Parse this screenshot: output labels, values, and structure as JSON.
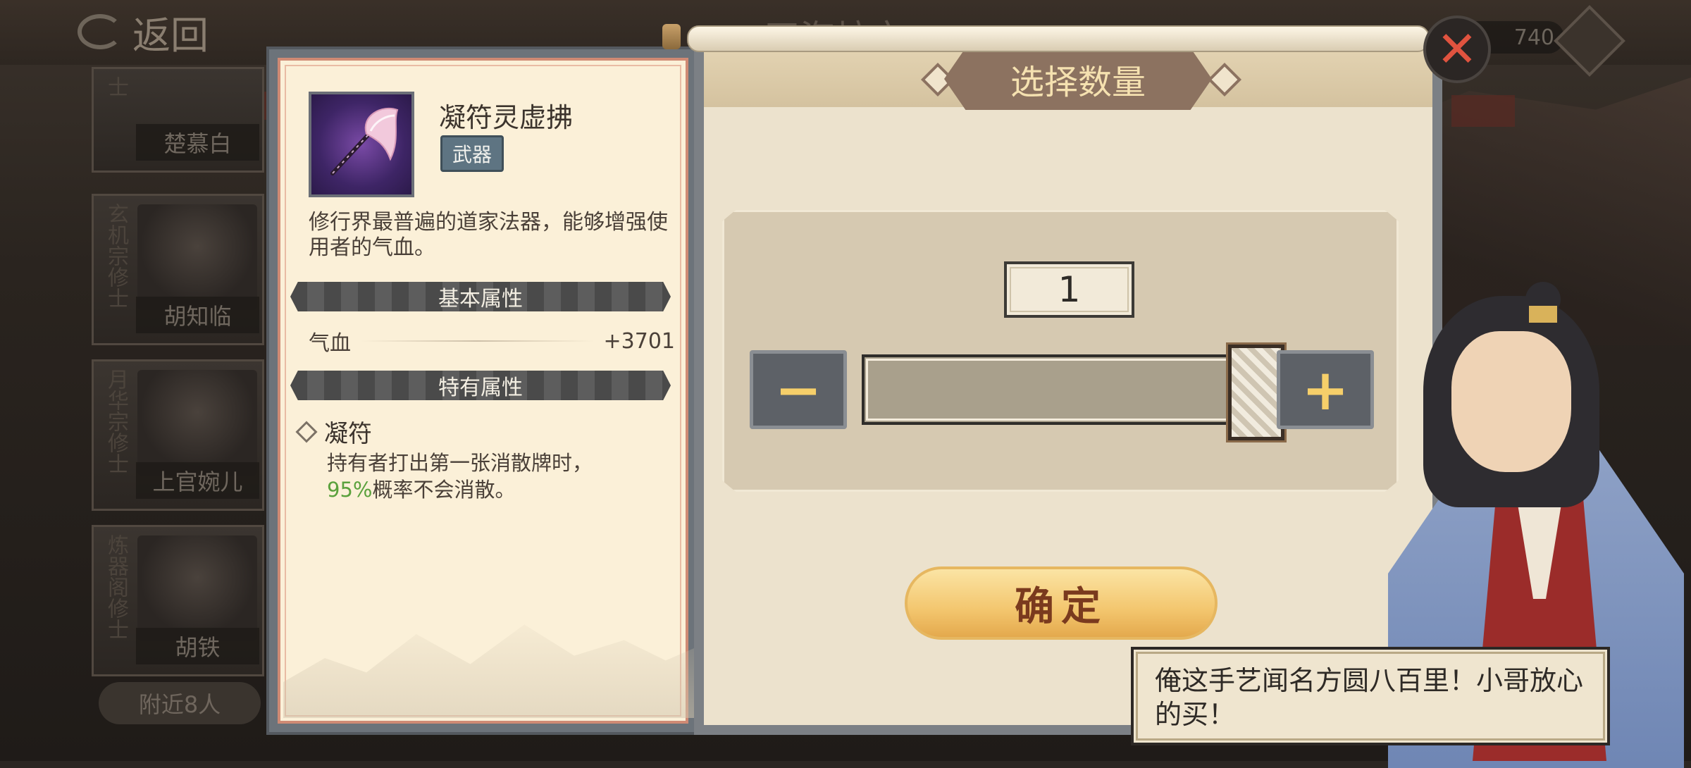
{
  "background": {
    "back_label": "返回",
    "title_partial": "四海坊市",
    "currency_value": "740",
    "side_cards": [
      {
        "sect": "士",
        "name": "楚慕白"
      },
      {
        "sect": "玄机宗修士",
        "name": "胡知临"
      },
      {
        "sect": "月华宗修士",
        "name": "上官婉儿"
      },
      {
        "sect": "炼器阁修士",
        "name": "胡铁"
      }
    ],
    "nearby_label": "附近8人"
  },
  "item": {
    "name": "凝符灵虚拂",
    "tag": "武器",
    "description": "修行界最普遍的道家法器，能够增强使用者的气血。",
    "basic_section": "基本属性",
    "stat_name": "气血",
    "stat_value": "+3701",
    "special_section": "特有属性",
    "skill_name": "凝符",
    "skill_desc_line1": "持有者打出第一张消散牌时，",
    "skill_percent": "95%",
    "skill_desc_line2_rest": "概率不会消散。"
  },
  "dialog": {
    "title": "选择数量",
    "quantity": "1",
    "minus_label": "−",
    "plus_label": "+",
    "slider_fraction": 1.0,
    "confirm_label": "确定"
  },
  "close_label": "✕",
  "npc": {
    "speech": "俺这手艺闻名方圆八百里！小哥放心的买！"
  },
  "colors": {
    "accent_gold": "#f6cf6a",
    "confirm_text": "#7a3a1e",
    "highlight_green": "#5aa13c",
    "close_red": "#e0533f"
  }
}
